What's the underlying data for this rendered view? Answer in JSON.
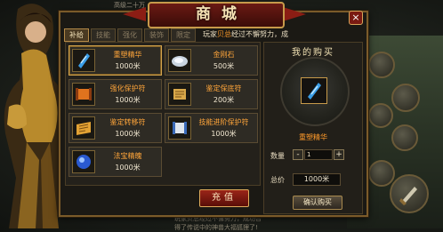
{
  "shop": {
    "title": "商城",
    "close_label": "×",
    "tabs": [
      "补给",
      "技能",
      "强化",
      "装饰",
      "限定"
    ],
    "notice": {
      "prefix": "玩家",
      "player": "贝总",
      "suffix": "经过不懈努力，成"
    },
    "items": [
      {
        "name": "重塑精华",
        "price": "1000米",
        "icon": "blue-crystal-icon",
        "selected": true
      },
      {
        "name": "金刚石",
        "price": "500米",
        "icon": "diamond-icon"
      },
      {
        "name": "强化保护符",
        "price": "1000米",
        "icon": "orange-scroll-icon"
      },
      {
        "name": "鉴定保底符",
        "price": "200米",
        "icon": "gold-scroll-icon"
      },
      {
        "name": "鉴定转移符",
        "price": "1000米",
        "icon": "gold-scroll-icon"
      },
      {
        "name": "技能进阶保护符",
        "price": "1000米",
        "icon": "blue-scroll-icon"
      },
      {
        "name": "法宝精魄",
        "price": "1000米",
        "icon": "blue-orb-icon"
      }
    ],
    "charge_label": "充值"
  },
  "purchase": {
    "title": "我的购买",
    "selected_name": "重塑精华",
    "qty_label": "数量",
    "qty_value": "1",
    "minus": "-",
    "plus": "+",
    "total_label": "总价",
    "total_value": "1000米",
    "buy_label": "确认购买"
  },
  "background": {
    "chat": "玩家贝总经过不懈努力，成功合",
    "chat2": "得了传说中的神兽大福狐狸了!",
    "top": "高级二十万"
  },
  "colors": {
    "accent_orange": "#ff9a2a",
    "frame_gold": "#c79a4a",
    "button_red": "#9a2418"
  }
}
